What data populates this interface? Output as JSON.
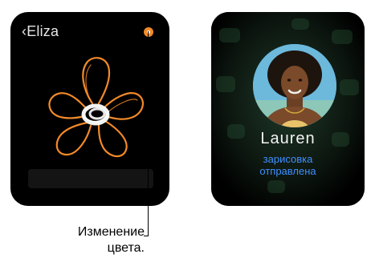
{
  "left_screen": {
    "back_label": "‹Eliza",
    "color_dot": "#f28a2a",
    "sketch_color": "#f28a2a",
    "icons": {
      "back": "chevron-left-icon",
      "color": "color-picker-icon"
    }
  },
  "right_screen": {
    "contact_name": "Lauren",
    "status_line_1": "зарисовка",
    "status_line_2": "отправлена",
    "status_color": "#3f8fff"
  },
  "callout": {
    "line_1": "Изменение",
    "line_2": "цвета."
  }
}
